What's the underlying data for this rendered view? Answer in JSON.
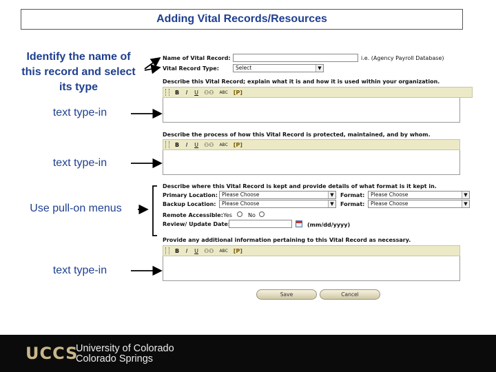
{
  "slide": {
    "title": "Adding Vital Records/Resources"
  },
  "annotations": {
    "identify_line1": "Identify the name of",
    "identify_line2": "this record and select",
    "identify_line3": "its type",
    "text_typein_1": "text type-in",
    "text_typein_2": "text type-in",
    "pull_on_menus": "Use pull-on menus",
    "text_typein_3": "text type-in"
  },
  "form": {
    "name_label": "Name of Vital Record:",
    "name_value": "",
    "name_hint": "i.e. (Agency Payroll Database)",
    "type_label": "Vital Record Type:",
    "type_selected": "Select",
    "describe_label": "Describe this Vital Record; explain what it is and how it is used within your organization.",
    "process_label": "Describe the process of how this Vital Record is protected, maintained, and by whom.",
    "where_label": "Describe where this Vital Record is kept and provide details of what format is it kept in.",
    "primary_label": "Primary Location:",
    "primary_selected": "Please Choose",
    "backup_label": "Backup Location:",
    "backup_selected": "Please Choose",
    "format_label": "Format:",
    "format1_selected": "Please Choose",
    "format2_label": "Format:",
    "format2_selected": "Please Choose",
    "remote_label": "Remote Accessible:",
    "yes_label": "Yes",
    "no_label": "No",
    "review_label": "Review/ Update Date:",
    "date_hint": "(mm/dd/yyyy)",
    "additional_label": "Provide any additional information pertaining to this Vital Record as necessary.",
    "save_label": "Save",
    "cancel_label": "Cancel"
  },
  "toolbar": {
    "bold": "B",
    "italic": "I",
    "underline": "U",
    "find": "⚇⚇",
    "check": "ABC",
    "paste": "[P]"
  },
  "footer": {
    "logo_text": "UCCS",
    "university_line1": "University of Colorado",
    "university_line2": "Colorado Springs"
  },
  "colors": {
    "annotation_blue": "#1f3f8f",
    "toolbar_bg": "#ece9c6",
    "footer_bg": "#0b0b0b",
    "logo_gold": "#c9b68a"
  }
}
